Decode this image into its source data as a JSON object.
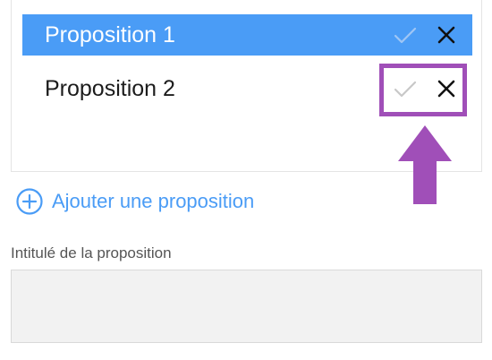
{
  "propositions": [
    {
      "label": "Proposition 1",
      "selected": true
    },
    {
      "label": "Proposition 2",
      "selected": false
    }
  ],
  "icons": {
    "confirm": "check-icon",
    "delete": "close-icon",
    "add": "plus-circle-icon",
    "annotation": "arrow-up-icon"
  },
  "add_link": {
    "label": "Ajouter une proposition"
  },
  "field": {
    "label": "Intitulé de la proposition",
    "value": ""
  },
  "colors": {
    "accent": "#4a9cf6",
    "highlight": "#a04fb8",
    "field_bg": "#f2f2f2"
  }
}
